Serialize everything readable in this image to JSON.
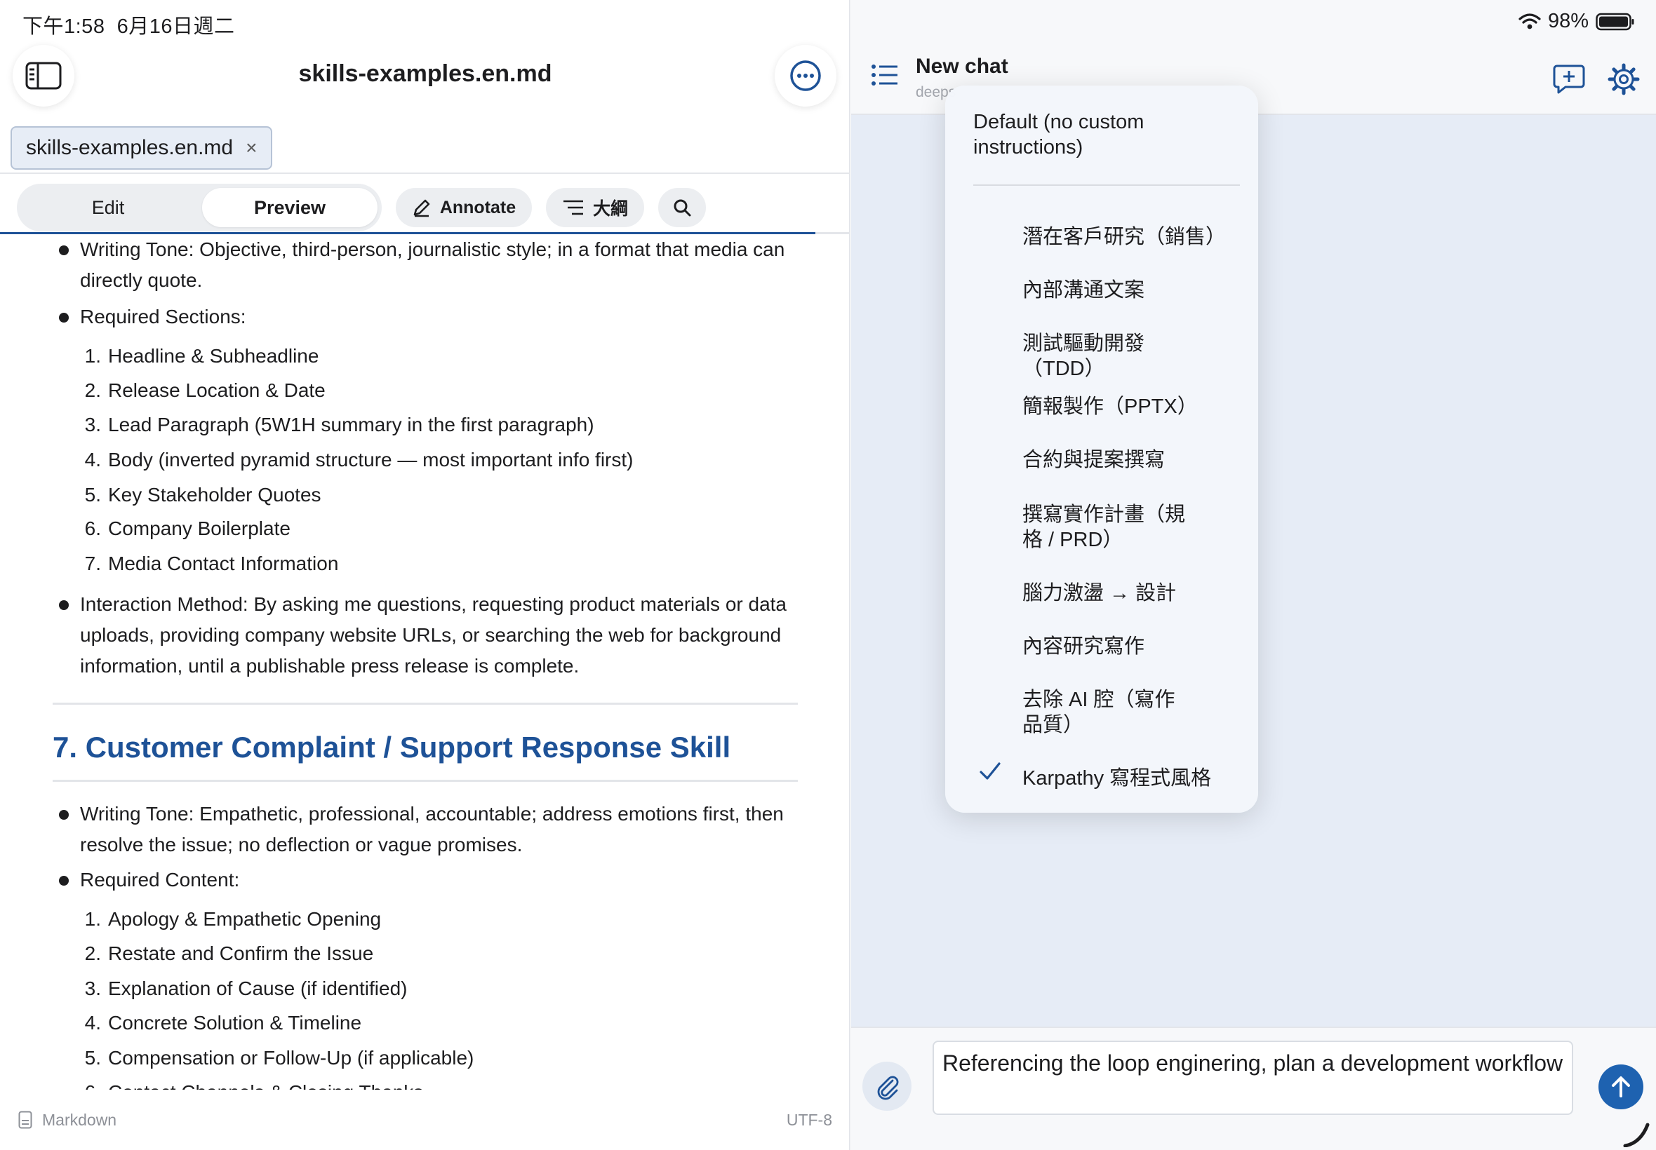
{
  "status": {
    "time": "下午1:58",
    "date": "6月16日週二",
    "battery": "98%"
  },
  "editor": {
    "title": "skills-examples.en.md",
    "tab_label": "skills-examples.en.md",
    "tab_close": "×",
    "toolbar": {
      "edit": "Edit",
      "preview": "Preview",
      "annotate": "Annotate",
      "outline": "大綱"
    },
    "content": {
      "tone_intro": "Writing Tone: Objective, third-person, journalistic style; in a format that media can directly quote.",
      "sections_label": "Required Sections:",
      "sections": [
        "Headline & Subheadline",
        "Release Location & Date",
        "Lead Paragraph (5W1H summary in the first paragraph)",
        "Body (inverted pyramid structure — most important info first)",
        "Key Stakeholder Quotes",
        "Company Boilerplate",
        "Media Contact Information"
      ],
      "interaction": "Interaction Method: By asking me questions, requesting product materials or data uploads, providing company website URLs, or searching the web for background information, until a publishable press release is complete.",
      "heading": "7. Customer Complaint / Support Response Skill",
      "tone2": "Writing Tone: Empathetic, professional, accountable; address emotions first, then resolve the issue; no deflection or vague promises.",
      "content_label": "Required Content:",
      "content_items": [
        "Apology & Empathetic Opening",
        "Restate and Confirm the Issue",
        "Explanation of Cause (if identified)",
        "Concrete Solution & Timeline",
        "Compensation or Follow-Up (if applicable)",
        "Contact Channels & Closing Thanks"
      ]
    },
    "footer": {
      "language": "Markdown",
      "encoding": "UTF-8"
    }
  },
  "chat": {
    "title": "New chat",
    "subtitle": "deeps",
    "input_text": "Referencing the loop enginering, plan a development workflow",
    "menu": {
      "default_item": "Default (no custom instructions)",
      "items": [
        "潛在客戶研究（銷售）",
        "內部溝通文案",
        "測試驅動開發（TDD）",
        "簡報製作（PPTX）",
        "合約與提案撰寫",
        "撰寫實作計畫（規格 / PRD）",
        "腦力激盪 → 設計",
        "內容研究寫作",
        "去除 AI 腔（寫作品質）",
        "Karpathy 寫程式風格"
      ],
      "selected": "Karpathy 寫程式風格"
    }
  },
  "colors": {
    "accent": "#1e5297",
    "send": "#1e62b0",
    "chat_bg": "#e6ecf6"
  }
}
